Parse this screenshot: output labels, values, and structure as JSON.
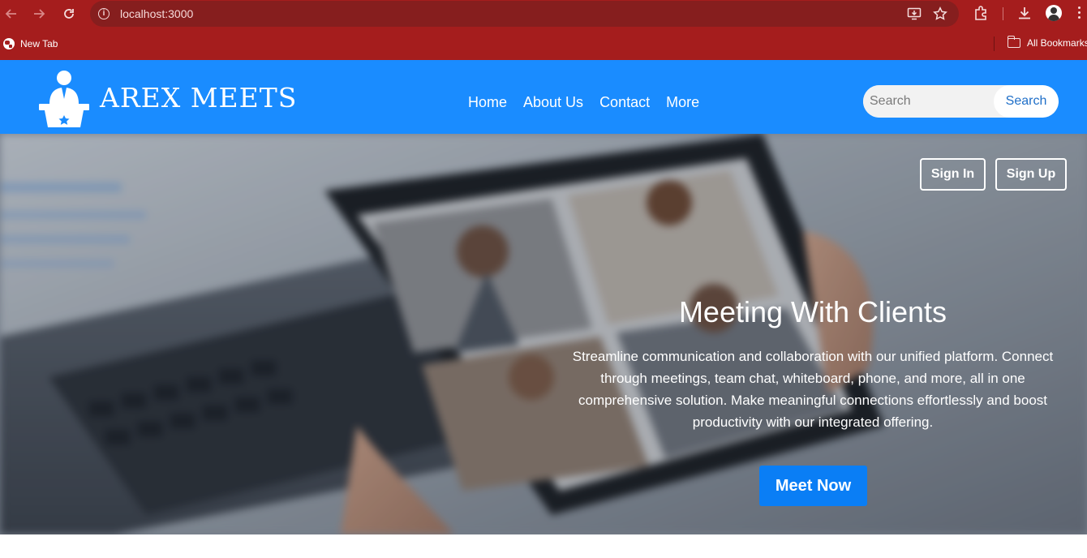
{
  "browser": {
    "url": "localhost:3000",
    "bookmarks": [
      {
        "label": "New Tab",
        "icon": "globe-icon"
      }
    ],
    "all_bookmarks_label": "All Bookmarks",
    "chrome_color": "#a51d1d"
  },
  "header": {
    "brand": "AREX MEETS",
    "nav": [
      {
        "label": "Home"
      },
      {
        "label": "About Us"
      },
      {
        "label": "Contact"
      },
      {
        "label": "More"
      }
    ],
    "search": {
      "placeholder": "Search",
      "button_label": "Search"
    },
    "color": "#1a8cff"
  },
  "hero": {
    "sign_in_label": "Sign In",
    "sign_up_label": "Sign Up",
    "title": "Meeting With Clients",
    "text": "Streamline communication and collaboration with our unified platform. Connect through meetings, team chat, whiteboard, phone, and more, all in one comprehensive solution. Make meaningful connections effortlessly and boost productivity with our integrated offering.",
    "cta_label": "Meet Now",
    "cta_color": "#0a7ef5"
  }
}
